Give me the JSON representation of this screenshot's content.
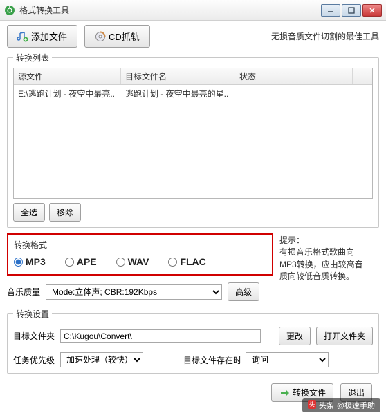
{
  "window": {
    "title": "格式转换工具"
  },
  "toolbar": {
    "add_file": "添加文件",
    "cd_grab": "CD抓轨",
    "tagline": "无损音质文件切割的最佳工具"
  },
  "list": {
    "legend": "转换列表",
    "col_source": "源文件",
    "col_target": "目标文件名",
    "col_status": "状态",
    "rows": [
      {
        "source": "E:\\逃跑计划 - 夜空中最亮..",
        "target": "逃跑计划 - 夜空中最亮的星..",
        "status": ""
      }
    ],
    "select_all": "全选",
    "remove": "移除"
  },
  "format": {
    "legend": "转换格式",
    "options": [
      "MP3",
      "APE",
      "WAV",
      "FLAC"
    ],
    "selected": "MP3"
  },
  "hint": {
    "title": "提示：",
    "text": "有损音乐格式歌曲向MP3转换，应由较高音质向较低音质转换。"
  },
  "quality": {
    "label": "音乐质量",
    "value": "Mode:立体声; CBR:192Kbps",
    "advanced": "高级"
  },
  "settings": {
    "legend": "转换设置",
    "dest_label": "目标文件夹",
    "dest_value": "C:\\Kugou\\Convert\\",
    "change": "更改",
    "open_folder": "打开文件夹",
    "priority_label": "任务优先级",
    "priority_value": "加速处理（较快）",
    "exist_label": "目标文件存在时",
    "exist_value": "询问"
  },
  "actions": {
    "convert": "转换文件",
    "exit": "退出"
  },
  "watermark": {
    "source": "头条",
    "author": "@极速手助"
  }
}
